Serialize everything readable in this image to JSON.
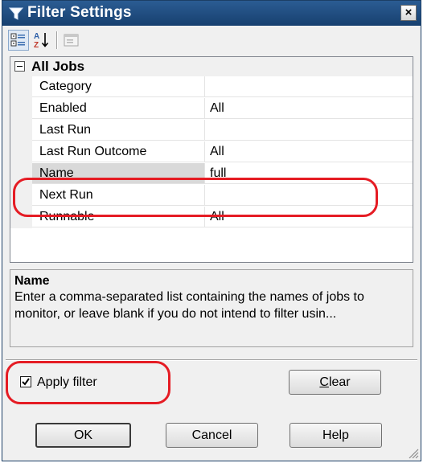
{
  "window": {
    "title": "Filter Settings",
    "close_label": "×"
  },
  "toolbar": {
    "buttons": [
      {
        "icon": "categorized-view-icon",
        "pressed": true
      },
      {
        "icon": "alphabetical-sort-icon",
        "pressed": false
      },
      {
        "icon": "property-pages-icon",
        "pressed": false
      }
    ]
  },
  "grid": {
    "category": "All Jobs",
    "rows": [
      {
        "name": "Category",
        "value": ""
      },
      {
        "name": "Enabled",
        "value": "All"
      },
      {
        "name": "Last Run",
        "value": ""
      },
      {
        "name": "Last Run Outcome",
        "value": "All"
      },
      {
        "name": "Name",
        "value": "full"
      },
      {
        "name": "Next Run",
        "value": ""
      },
      {
        "name": "Runnable",
        "value": "All"
      }
    ],
    "selected_row": "Name"
  },
  "description": {
    "title": "Name",
    "text": "Enter a comma-separated list containing the names of jobs to monitor, or leave blank if you do not intend to filter usin..."
  },
  "apply_filter": {
    "label": "Apply filter",
    "checked": true
  },
  "buttons": {
    "clear": "Clear",
    "ok": "OK",
    "cancel": "Cancel",
    "help": "Help"
  },
  "colors": {
    "titlebar": "#1f4b7e",
    "annotation": "#e51c24"
  }
}
